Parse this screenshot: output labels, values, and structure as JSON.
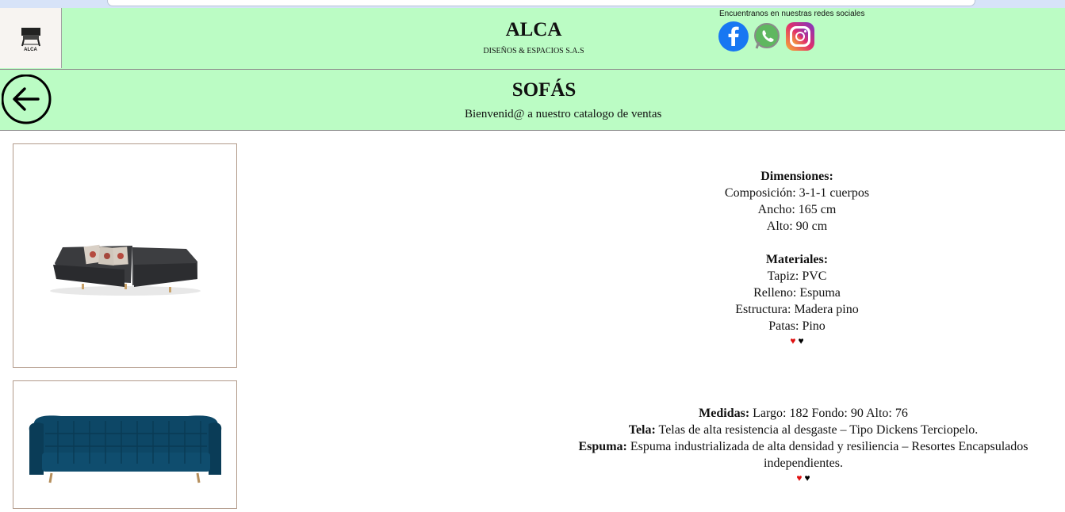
{
  "header": {
    "logo_text": "ALCA",
    "brand_title": "ALCA",
    "brand_subtitle": "DISEÑOS & ESPACIOS S.A.S",
    "social_label": "Encuentranos en nuestras redes sociales",
    "social": [
      {
        "name": "facebook-icon",
        "color": "#1877f2"
      },
      {
        "name": "whatsapp-icon",
        "color": "#4cae4f"
      },
      {
        "name": "instagram-icon",
        "color": "#d9317a"
      }
    ]
  },
  "hero": {
    "title": "SOFÁS",
    "subtitle": "Bienvenid@ a nuestro catalogo de ventas"
  },
  "products": [
    {
      "dim_heading": "Dimensiones:",
      "dim_lines": [
        "Composición: 3-1-1 cuerpos",
        "Ancho: 165 cm",
        "Alto: 90 cm"
      ],
      "mat_heading": "Materiales:",
      "mat_lines": [
        "Tapiz: PVC",
        "Relleno: Espuma",
        "Estructura: Madera pino",
        "Patas: Pino"
      ],
      "sofa_color": "#2f3033"
    },
    {
      "medidas_label": "Medidas:",
      "medidas_value": "Largo: 182 Fondo: 90 Alto: 76",
      "tela_label": "Tela:",
      "tela_value": "Telas de alta resistencia al desgaste – Tipo Dickens Terciopelo.",
      "espuma_label": "Espuma:",
      "espuma_value": "Espuma industrializada de alta densidad y resiliencia – Resortes Encapsulados independientes.",
      "sofa_color": "#0d4766"
    }
  ],
  "hearts": {
    "like": "♥",
    "fav": "♥",
    "like_color": "#e01010",
    "fav_color": "#000000"
  }
}
